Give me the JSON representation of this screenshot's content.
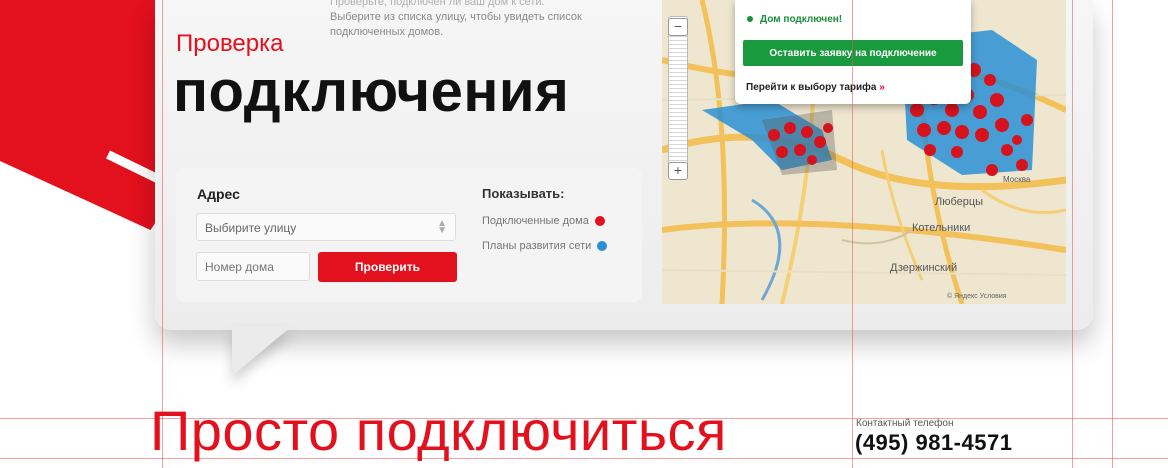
{
  "intro": {
    "line1": "Проверьте, подключен ли ваш дом к сети.",
    "line2": "Выберите из списка улицу, чтобы увидеть список подключенных домов."
  },
  "title": {
    "small": "Проверка",
    "big": "подключения"
  },
  "form": {
    "address_label": "Адрес",
    "street_select_value": "Выбирите улицу",
    "house_placeholder": "Номер дома",
    "check_button": "Проверить"
  },
  "legend": {
    "title": "Показывать:",
    "items": [
      {
        "label": "Подключенные дома",
        "color": "#e3101d"
      },
      {
        "label": "Планы развития сети",
        "color": "#2a8fd6"
      }
    ]
  },
  "popup": {
    "status": "Дом подключен!",
    "apply_button": "Оставить заявку на подключение",
    "tariff_link": "Перейти к выбору тарифа",
    "tariff_arrow": "»"
  },
  "map": {
    "labels": [
      "Люберцы",
      "Котельники",
      "Дзержинский",
      "Москва"
    ],
    "copyright": "© Яндекс  Условия",
    "zoom_in": "+",
    "zoom_out": "−"
  },
  "footer": {
    "slogan": "Просто подключиться",
    "phone_caption": "Контактный телефон",
    "phone": "(495) 981-4571"
  },
  "colors": {
    "brand_red": "#e3101d",
    "connected_green": "#1a9a3e",
    "plan_blue": "#2a8fd6"
  }
}
